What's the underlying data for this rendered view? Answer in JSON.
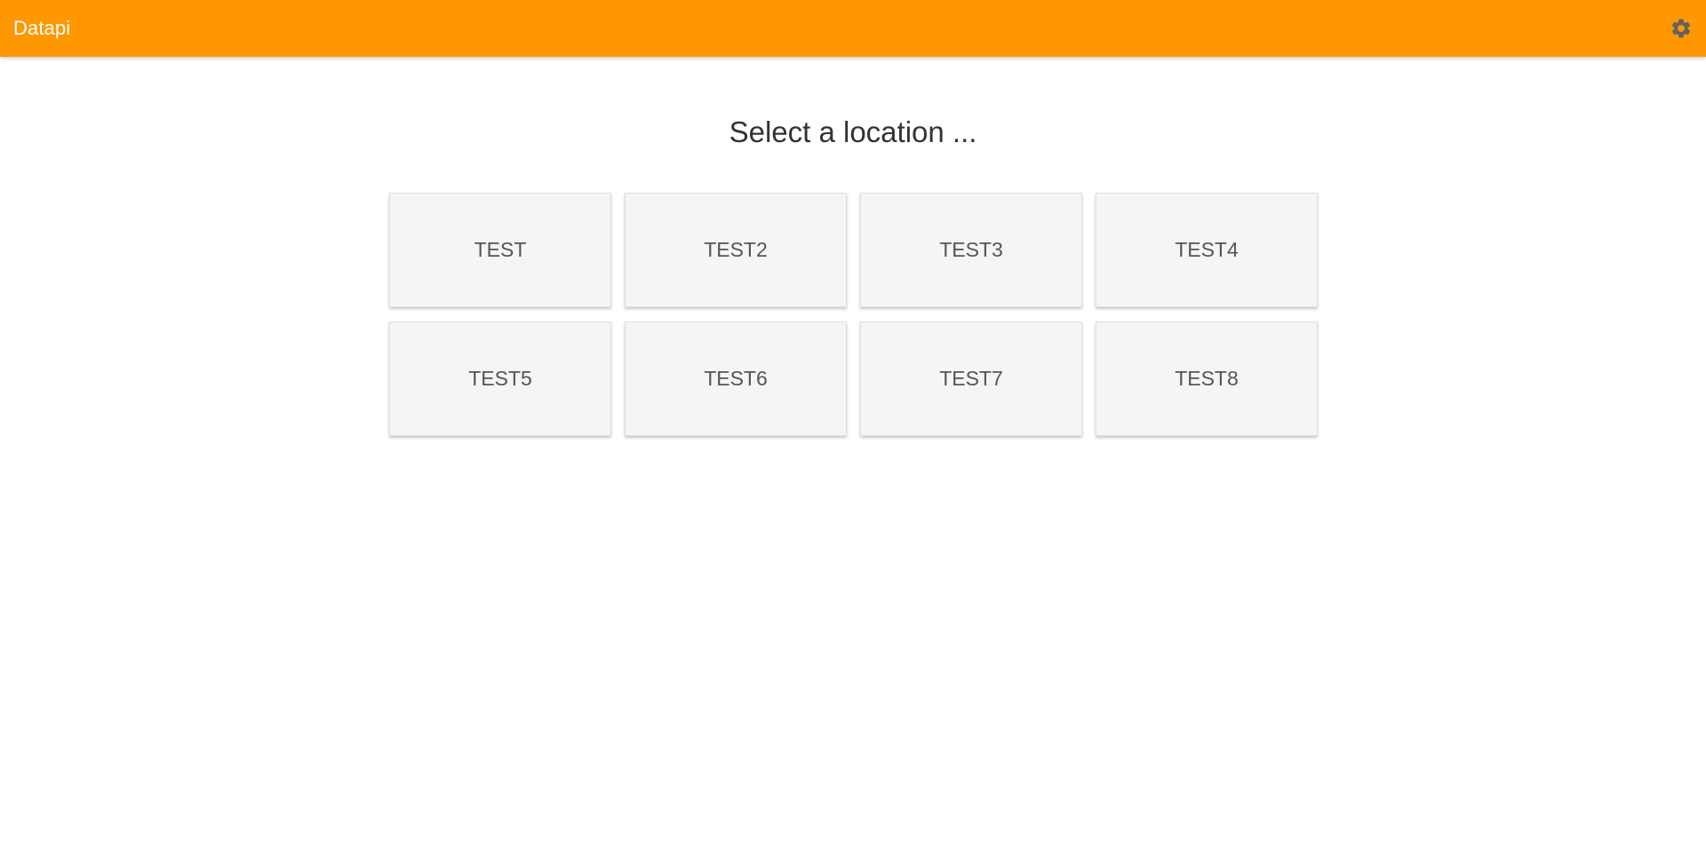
{
  "app_bar": {
    "title": "Datapi",
    "background_color": "#ff9800",
    "settings_icon": "gear-icon"
  },
  "main": {
    "heading": "Select a location ...",
    "locations": [
      {
        "label": "TEST"
      },
      {
        "label": "TEST2"
      },
      {
        "label": "TEST3"
      },
      {
        "label": "TEST4"
      },
      {
        "label": "TEST5"
      },
      {
        "label": "TEST6"
      },
      {
        "label": "TEST7"
      },
      {
        "label": "TEST8"
      }
    ]
  }
}
